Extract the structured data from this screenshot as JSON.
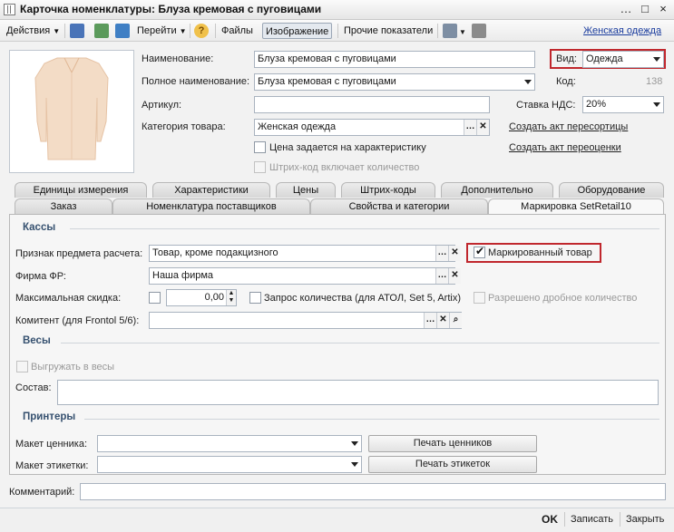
{
  "window": {
    "title": "Карточка номенклатуры: Блуза кремовая с пуговицами",
    "controls": [
      "…",
      "□",
      "×"
    ]
  },
  "toolbar": {
    "actions_label": "Действия",
    "goto_label": "Перейти",
    "files_label": "Файлы",
    "image_label": "Изображение",
    "other_label": "Прочие показатели",
    "category_link": "Женская одежда"
  },
  "header": {
    "name_label": "Наименование:",
    "name_value": "Блуза кремовая с пуговицами",
    "full_name_label": "Полное наименование:",
    "full_name_value": "Блуза кремовая с пуговицами",
    "article_label": "Артикул:",
    "article_value": "",
    "category_label": "Категория товара:",
    "category_value": "Женская одежда",
    "price_by_char_label": "Цена задается на характеристику",
    "barcode_qty_label": "Штрих-код включает количество",
    "kind_label": "Вид:",
    "kind_value": "Одежда",
    "code_label": "Код:",
    "code_value": "138",
    "vat_label": "Ставка НДС:",
    "vat_value": "20%",
    "create_resort_link": "Создать акт пересортицы",
    "create_reassess_link": "Создать акт переоценки"
  },
  "tabs_row1": [
    "Единицы измерения",
    "Характеристики",
    "Цены",
    "Штрих-коды",
    "Дополнительно",
    "Оборудование"
  ],
  "tabs_row2": [
    "Заказ",
    "Номенклатура поставщиков",
    "Свойства и категории",
    "Маркировка SetRetail10"
  ],
  "kassy": {
    "title": "Кассы",
    "calc_subject_label": "Признак предмета расчета:",
    "calc_subject_value": "Товар, кроме подакцизного",
    "marked_label": "Маркированный товар",
    "firm_label": "Фирма ФР:",
    "firm_value": "Наша фирма",
    "max_discount_label": "Максимальная скидка:",
    "max_discount_value": "0,00",
    "qty_request_label": "Запрос количества (для АТОЛ, Set 5, Artix)",
    "fractional_label": "Разрешено дробное количество",
    "committent_label": "Комитент (для Frontol 5/6):",
    "committent_value": ""
  },
  "vesy": {
    "title": "Весы",
    "export_label": "Выгружать в весы",
    "composition_label": "Состав:",
    "composition_value": ""
  },
  "printers": {
    "title": "Принтеры",
    "price_tag_label": "Макет ценника:",
    "price_tag_value": "",
    "print_price_tags": "Печать ценников",
    "label_label": "Макет этикетки:",
    "label_value": "",
    "print_labels": "Печать этикеток"
  },
  "footer": {
    "comment_label": "Комментарий:",
    "comment_value": "",
    "ok": "OK",
    "save": "Записать",
    "close": "Закрыть"
  },
  "colors": {
    "accent_red": "#c0272d",
    "link_blue": "#1a3c9e",
    "section_blue": "#35506f"
  }
}
